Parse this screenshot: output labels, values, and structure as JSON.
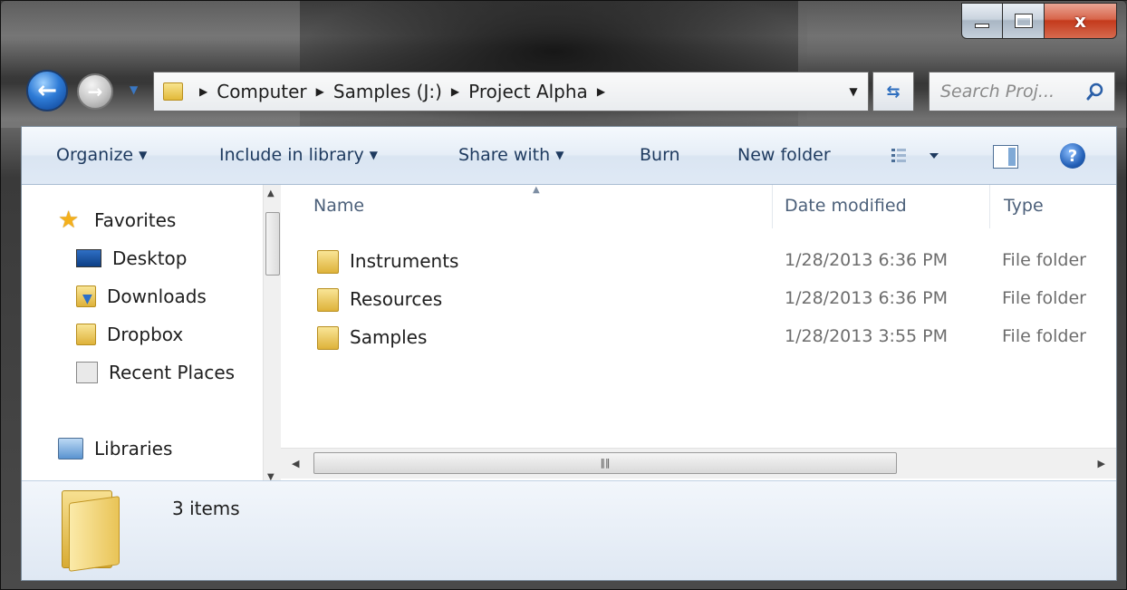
{
  "window": {
    "caption_buttons": {
      "minimize": "minimize",
      "maximize": "maximize",
      "close": "x"
    }
  },
  "navigation": {
    "breadcrumbs": [
      "Computer",
      "Samples (J:)",
      "Project Alpha"
    ],
    "search_placeholder": "Search Proj..."
  },
  "command_bar": {
    "organize": "Organize",
    "include_in_library": "Include in library",
    "share_with": "Share with",
    "burn": "Burn",
    "new_folder": "New folder"
  },
  "nav_pane": {
    "favorites_header": "Favorites",
    "favorites": [
      {
        "label": "Desktop",
        "icon": "desktop-icon"
      },
      {
        "label": "Downloads",
        "icon": "downloads-folder-icon"
      },
      {
        "label": "Dropbox",
        "icon": "folder-icon"
      },
      {
        "label": "Recent Places",
        "icon": "recent-places-icon"
      }
    ],
    "libraries_header": "Libraries"
  },
  "file_list": {
    "columns": {
      "name": "Name",
      "date_modified": "Date modified",
      "type": "Type"
    },
    "rows": [
      {
        "name": "Instruments",
        "date": "1/28/2013 6:36 PM",
        "type": "File folder"
      },
      {
        "name": "Resources",
        "date": "1/28/2013 6:36 PM",
        "type": "File folder"
      },
      {
        "name": "Samples",
        "date": "1/28/2013 3:55 PM",
        "type": "File folder"
      }
    ]
  },
  "details_pane": {
    "item_count": "3 items"
  },
  "colors": {
    "accent": "#2e7bd6",
    "folder": "#e2b93a",
    "command_text": "#1e3a5f"
  }
}
